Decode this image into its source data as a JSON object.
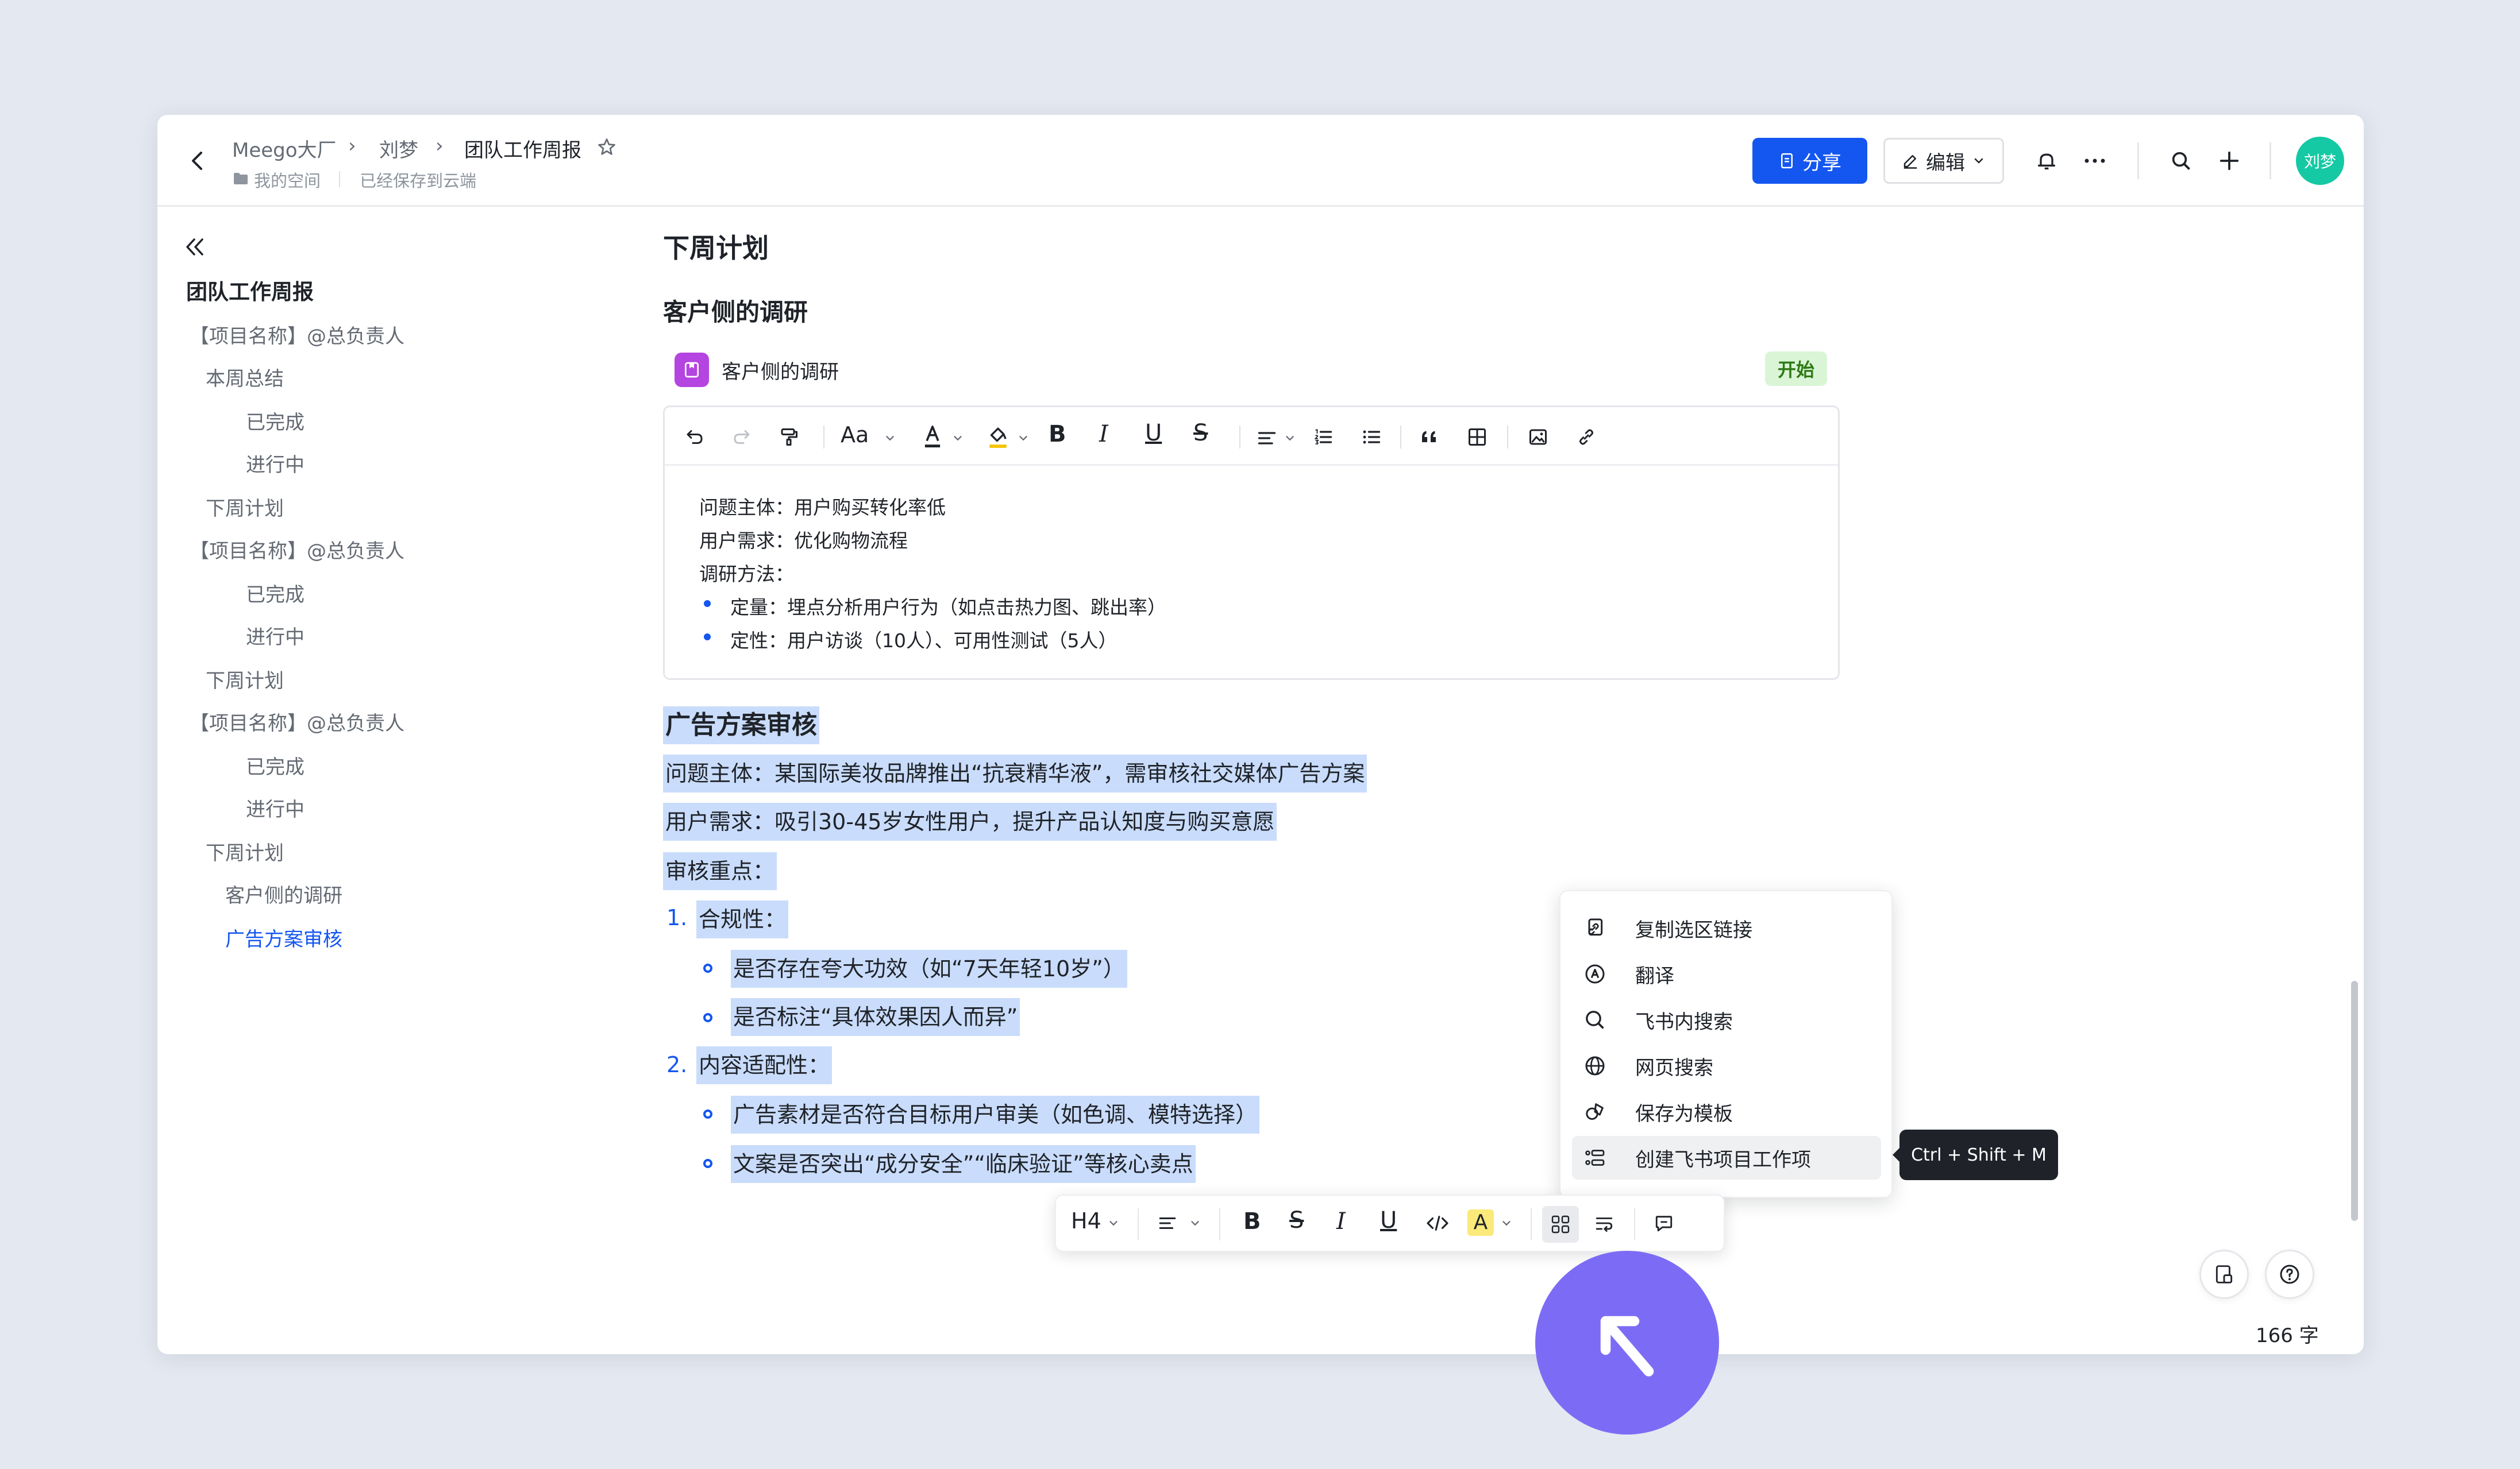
{
  "header": {
    "breadcrumb": [
      "Meego大厂",
      "刘梦",
      "团队工作周报"
    ],
    "sub_space": "我的空间",
    "sub_status": "已经保存到云端",
    "share_label": "分享",
    "edit_label": "编辑",
    "avatar_text": "刘梦"
  },
  "sidebar": {
    "root": "团队工作周报",
    "items": [
      {
        "label": "【项目名称】@总负责人"
      },
      {
        "label": "本周总结"
      },
      {
        "label": "已完成"
      },
      {
        "label": "进行中"
      },
      {
        "label": "下周计划"
      },
      {
        "label": "【项目名称】@总负责人"
      },
      {
        "label": "已完成"
      },
      {
        "label": "进行中"
      },
      {
        "label": "下周计划"
      },
      {
        "label": "【项目名称】@总负责人"
      },
      {
        "label": "已完成"
      },
      {
        "label": "进行中"
      },
      {
        "label": "下周计划"
      },
      {
        "label": "客户侧的调研"
      },
      {
        "label": "广告方案审核"
      }
    ]
  },
  "doc": {
    "h_next_week": "下周计划",
    "h_research": "客户侧的调研",
    "task_title": "客户侧的调研",
    "task_status": "开始",
    "editor_lines": [
      "问题主体：用户购买转化率低",
      "用户需求：优化购物流程",
      "调研方法：",
      "定量：埋点分析用户行为（如点击热力图、跳出率）",
      "定性：用户访谈（10人）、可用性测试（5人）"
    ],
    "ad": {
      "title": "广告方案审核",
      "subject": "问题主体：某国际美妆品牌推出“抗衰精华液”，需审核社交媒体广告方案",
      "demand": "用户需求：吸引30-45岁女性用户，提升产品认知度与购买意愿",
      "focus": "审核重点：",
      "n1_label": "1.",
      "n1": "合规性：",
      "n1_a": "是否存在夸大功效（如“7天年轻10岁”）",
      "n1_b": "是否标注“具体效果因人而异”",
      "n2_label": "2.",
      "n2": "内容适配性：",
      "n2_a": "广告素材是否符合目标用户审美（如色调、模特选择）",
      "n2_b": "文案是否突出“成分安全”“临床验证”等核心卖点"
    }
  },
  "toolbar": {
    "font_label": "Aa",
    "heading_label": "H4"
  },
  "context_menu": {
    "items": [
      {
        "label": "复制选区链接",
        "icon": "link-copy-icon"
      },
      {
        "label": "翻译",
        "icon": "translate-icon"
      },
      {
        "label": "飞书内搜索",
        "icon": "search-icon"
      },
      {
        "label": "网页搜索",
        "icon": "globe-icon"
      },
      {
        "label": "保存为模板",
        "icon": "template-icon"
      },
      {
        "label": "创建飞书项目工作项",
        "icon": "work-item-icon"
      }
    ],
    "shortcut": "Ctrl + Shift + M"
  },
  "footer": {
    "word_count": "166 字"
  },
  "colors": {
    "accent": "#1456f0",
    "selection": "#c9dcfb",
    "status_green": "#d9f5d6",
    "cursor": "#7c6cf5"
  }
}
